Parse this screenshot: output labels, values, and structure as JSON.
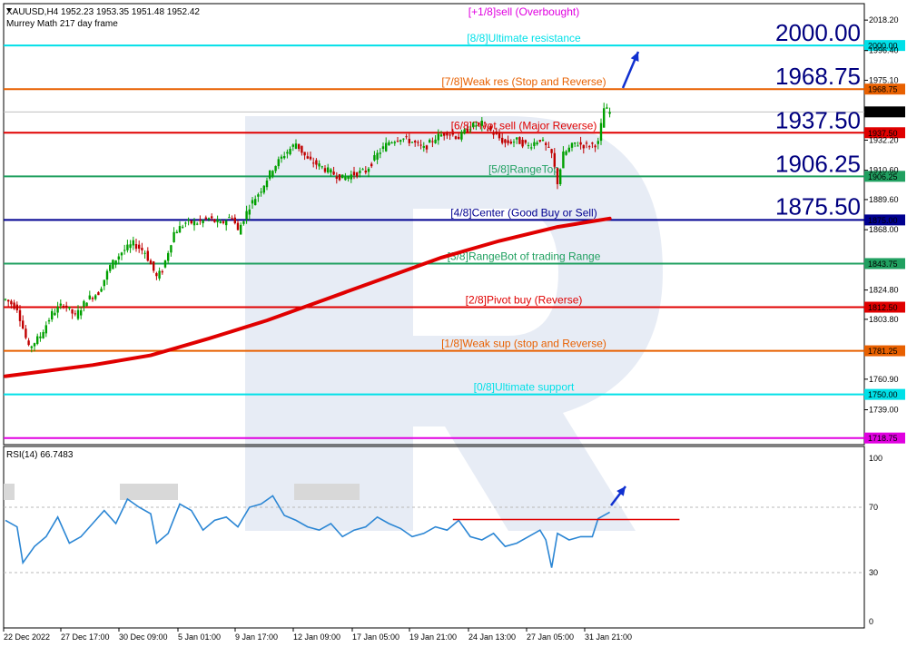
{
  "header": {
    "symbol_line": "XAUUSD,H4  1952.23 1953.35 1951.48 1952.42",
    "indicator_name": "Murrey Math 217 day frame",
    "rsi_label": "RSI(14) 66.7483"
  },
  "colors": {
    "bull_candle": "#00a000",
    "bear_candle": "#c00000",
    "ma_line": "#e00000",
    "rsi_line": "#2b86d4",
    "arrow": "#1030d0",
    "watermark": "#dfe6f2"
  },
  "chart_data": [
    {
      "type": "line",
      "title": "",
      "symbol": "XAUUSD",
      "timeframe": "H4",
      "ylim": [
        1714,
        2030
      ],
      "y_ticks": [
        2018.2,
        1996.4,
        1975.1,
        1953.7,
        1932.2,
        1910.6,
        1889.6,
        1868.0,
        1824.8,
        1803.8,
        1760.9,
        1739.0
      ],
      "y_tick_labels": [
        "2018.20",
        "1996.40",
        "1975.10",
        "1953.70",
        "1932.20",
        "1910.60",
        "1889.60",
        "1868.00",
        "1824.80",
        "1803.80",
        "1760.90",
        "1739.00"
      ],
      "x_labels": [
        "22 Dec 2022",
        "27 Dec 17:00",
        "30 Dec 09:00",
        "5 Jan 01:00",
        "9 Jan 17:00",
        "12 Jan 09:00",
        "17 Jan 05:00",
        "19 Jan 21:00",
        "24 Jan 13:00",
        "27 Jan 05:00",
        "31 Jan 21:00"
      ],
      "last_price": 1952.42,
      "last_price_label": "1952.42",
      "murrey_levels": [
        {
          "price": 2031.25,
          "label": "[+1/8]sell (Overbought)",
          "color": "#e000e0",
          "tag": ""
        },
        {
          "price": 2000.0,
          "label": "[8/8]Ultimate resistance",
          "color": "#00e0e8",
          "tag": "2000.00"
        },
        {
          "price": 1968.75,
          "label": "[7/8]Weak res (Stop and Reverse)",
          "color": "#e86000",
          "tag": "1968.75"
        },
        {
          "price": 1937.5,
          "label": "[6/8]Pivot sell (Major Reverse)",
          "color": "#e00000",
          "tag": "1937.50"
        },
        {
          "price": 1906.25,
          "label": "[5/8]RangeTop",
          "color": "#20a060",
          "tag": "1906.25"
        },
        {
          "price": 1875.0,
          "label": "[4/8]Center (Good Buy or Sell)",
          "color": "#000090",
          "tag": "1875.00"
        },
        {
          "price": 1843.75,
          "label": "[3/8]RangeBot of trading Range",
          "color": "#20a060",
          "tag": "1843.75"
        },
        {
          "price": 1812.5,
          "label": "[2/8]Pivot buy (Reverse)",
          "color": "#e00000",
          "tag": "1812.50"
        },
        {
          "price": 1781.25,
          "label": "[1/8]Weak sup (stop and Reverse)",
          "color": "#e86000",
          "tag": "1781.25"
        },
        {
          "price": 1750.0,
          "label": "[0/8]Ultimate support",
          "color": "#00e0e8",
          "tag": "1750.00"
        },
        {
          "price": 1718.75,
          "label": "",
          "color": "#e000e0",
          "tag": "1718.75"
        }
      ],
      "big_labels": [
        "2000.00",
        "1968.75",
        "1937.50",
        "1906.25",
        "1875.50"
      ],
      "big_label_prices": [
        2000.0,
        1968.75,
        1937.5,
        1906.25,
        1875.5
      ],
      "price_path": [
        [
          0,
          1818
        ],
        [
          4,
          1812
        ],
        [
          8,
          1783
        ],
        [
          12,
          1792
        ],
        [
          16,
          1808
        ],
        [
          20,
          1815
        ],
        [
          24,
          1806
        ],
        [
          28,
          1818
        ],
        [
          32,
          1823
        ],
        [
          36,
          1842
        ],
        [
          40,
          1852
        ],
        [
          44,
          1858
        ],
        [
          48,
          1852
        ],
        [
          52,
          1834
        ],
        [
          54,
          1839
        ],
        [
          58,
          1866
        ],
        [
          62,
          1873
        ],
        [
          66,
          1873
        ],
        [
          70,
          1876
        ],
        [
          74,
          1872
        ],
        [
          78,
          1878
        ],
        [
          80,
          1867
        ],
        [
          84,
          1885
        ],
        [
          88,
          1897
        ],
        [
          92,
          1912
        ],
        [
          96,
          1922
        ],
        [
          100,
          1930
        ],
        [
          104,
          1918
        ],
        [
          108,
          1914
        ],
        [
          112,
          1909
        ],
        [
          116,
          1905
        ],
        [
          120,
          1908
        ],
        [
          124,
          1910
        ],
        [
          128,
          1922
        ],
        [
          132,
          1931
        ],
        [
          136,
          1934
        ],
        [
          140,
          1931
        ],
        [
          144,
          1926
        ],
        [
          148,
          1934
        ],
        [
          152,
          1938
        ],
        [
          156,
          1934
        ],
        [
          160,
          1942
        ],
        [
          164,
          1944
        ],
        [
          168,
          1937
        ],
        [
          172,
          1930
        ],
        [
          176,
          1932
        ],
        [
          180,
          1928
        ],
        [
          184,
          1933
        ],
        [
          188,
          1922
        ],
        [
          190,
          1902
        ],
        [
          192,
          1922
        ],
        [
          196,
          1930
        ],
        [
          200,
          1928
        ],
        [
          204,
          1930
        ],
        [
          206,
          1955
        ],
        [
          208,
          1952
        ]
      ],
      "ma_217": [
        [
          0,
          1763
        ],
        [
          30,
          1771
        ],
        [
          50,
          1778
        ],
        [
          70,
          1790
        ],
        [
          90,
          1803
        ],
        [
          110,
          1818
        ],
        [
          130,
          1833
        ],
        [
          150,
          1848
        ],
        [
          170,
          1860
        ],
        [
          190,
          1870
        ],
        [
          208,
          1876
        ]
      ],
      "rsi": {
        "ylim": [
          0,
          100
        ],
        "ticks": [
          100,
          70,
          30,
          0
        ],
        "tick_labels": [
          "100",
          "70",
          "30",
          "0"
        ],
        "levels": [
          70,
          30
        ],
        "values": [
          [
            0,
            62
          ],
          [
            4,
            58
          ],
          [
            6,
            36
          ],
          [
            10,
            46
          ],
          [
            14,
            52
          ],
          [
            18,
            64
          ],
          [
            22,
            48
          ],
          [
            26,
            52
          ],
          [
            30,
            60
          ],
          [
            34,
            68
          ],
          [
            38,
            60
          ],
          [
            42,
            75
          ],
          [
            46,
            70
          ],
          [
            50,
            66
          ],
          [
            52,
            48
          ],
          [
            56,
            54
          ],
          [
            60,
            72
          ],
          [
            64,
            68
          ],
          [
            68,
            56
          ],
          [
            72,
            62
          ],
          [
            76,
            64
          ],
          [
            80,
            58
          ],
          [
            84,
            70
          ],
          [
            88,
            72
          ],
          [
            92,
            77
          ],
          [
            96,
            65
          ],
          [
            100,
            62
          ],
          [
            104,
            58
          ],
          [
            108,
            56
          ],
          [
            112,
            60
          ],
          [
            116,
            52
          ],
          [
            120,
            56
          ],
          [
            124,
            58
          ],
          [
            128,
            64
          ],
          [
            132,
            60
          ],
          [
            136,
            57
          ],
          [
            140,
            52
          ],
          [
            144,
            54
          ],
          [
            148,
            58
          ],
          [
            152,
            56
          ],
          [
            156,
            62
          ],
          [
            160,
            52
          ],
          [
            164,
            50
          ],
          [
            168,
            54
          ],
          [
            172,
            46
          ],
          [
            176,
            48
          ],
          [
            180,
            52
          ],
          [
            184,
            56
          ],
          [
            186,
            50
          ],
          [
            188,
            33
          ],
          [
            190,
            54
          ],
          [
            194,
            50
          ],
          [
            198,
            52
          ],
          [
            202,
            52
          ],
          [
            204,
            63
          ],
          [
            208,
            67
          ]
        ],
        "resistance_line": {
          "from": 154,
          "to": 232,
          "value": 62.5
        }
      }
    }
  ]
}
